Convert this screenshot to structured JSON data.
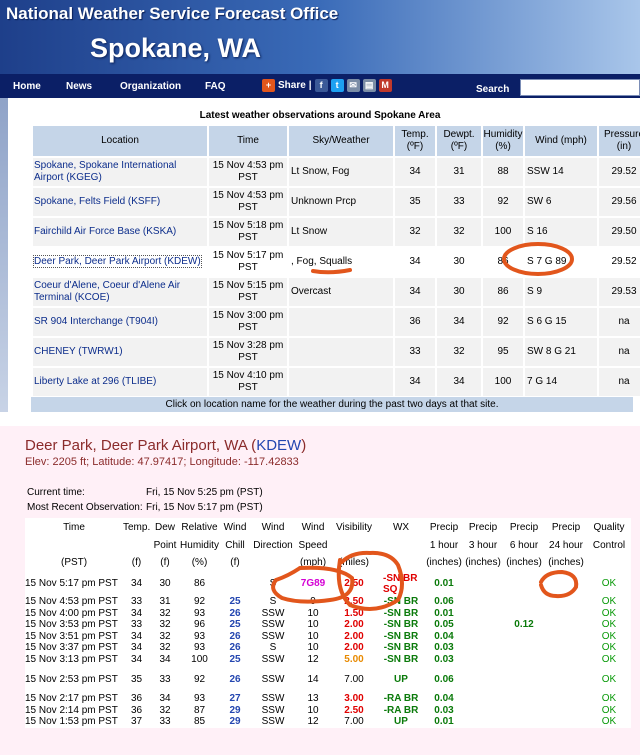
{
  "header": {
    "office": "National Weather Service Forecast Office",
    "city": "Spokane, WA"
  },
  "nav": {
    "items": [
      "Home",
      "News",
      "Organization",
      "FAQ"
    ],
    "share_label": "Share",
    "share_separator": "|",
    "search_label": "Search"
  },
  "obs": {
    "title": "Latest weather observations around Spokane Area",
    "headers": {
      "location": "Location",
      "time": "Time",
      "sky": "Sky/Weather",
      "temp": "Temp. (ºF)",
      "dewpt": "Dewpt. (ºF)",
      "humidity": "Humidity (%)",
      "wind": "Wind (mph)",
      "pressure": "Pressure (in)"
    },
    "rows": [
      {
        "location": "Spokane, Spokane International Airport (KGEG)",
        "time": "15 Nov 4:53 pm PST",
        "sky": "Lt Snow, Fog",
        "temp": "34",
        "dewpt": "31",
        "humidity": "88",
        "wind": "SSW 14",
        "pressure": "29.52"
      },
      {
        "location": "Spokane, Felts Field (KSFF)",
        "time": "15 Nov 4:53 pm PST",
        "sky": "Unknown Prcp",
        "temp": "35",
        "dewpt": "33",
        "humidity": "92",
        "wind": "SW 6",
        "pressure": "29.56"
      },
      {
        "location": "Fairchild Air Force Base (KSKA)",
        "time": "15 Nov 5:18 pm PST",
        "sky": "Lt Snow",
        "temp": "32",
        "dewpt": "32",
        "humidity": "100",
        "wind": "S 16",
        "pressure": "29.50"
      },
      {
        "location": "Deer Park, Deer Park Airport (KDEW)",
        "time": "15 Nov 5:17 pm PST",
        "sky": ", Fog, Squalls",
        "temp": "34",
        "dewpt": "30",
        "humidity": "86",
        "wind": "S 7 G 89",
        "pressure": "29.52"
      },
      {
        "location": "Coeur d'Alene, Coeur d'Alene Air Terminal (KCOE)",
        "time": "15 Nov 5:15 pm PST",
        "sky": "Overcast",
        "temp": "34",
        "dewpt": "30",
        "humidity": "86",
        "wind": "S 9",
        "pressure": "29.53"
      },
      {
        "location": "SR 904 Interchange (T904I)",
        "time": "15 Nov 3:00 pm PST",
        "sky": "",
        "temp": "36",
        "dewpt": "34",
        "humidity": "92",
        "wind": "S 6 G 15",
        "pressure": "na"
      },
      {
        "location": "CHENEY (TWRW1)",
        "time": "15 Nov 3:28 pm PST",
        "sky": "",
        "temp": "33",
        "dewpt": "32",
        "humidity": "95",
        "wind": "SW 8 G 21",
        "pressure": "na"
      },
      {
        "location": "Liberty Lake at 296 (TLIBE)",
        "time": "15 Nov 4:10 pm PST",
        "sky": "",
        "temp": "34",
        "dewpt": "34",
        "humidity": "100",
        "wind": "7 G 14",
        "pressure": "na"
      }
    ],
    "note": "Click on location name for the weather during the past two days at that site."
  },
  "station": {
    "name": "Deer Park, Deer Park Airport, WA (",
    "id": "KDEW",
    "name_close": ")",
    "elev_line": "Elev: 2205 ft; Latitude: 47.97417; Longitude: -117.42833",
    "current_time_label": "Current time:",
    "current_time": "Fri, 15 Nov 5:25 pm (PST)",
    "recent_obs_label": "Most Recent Observation:",
    "recent_obs": "Fri, 15 Nov 5:17 pm (PST)"
  },
  "hist": {
    "header_row1": [
      "Time",
      "Temp.",
      "Dew",
      "Relative",
      "Wind",
      "Wind",
      "Wind",
      "Visibility",
      "WX",
      "Precip",
      "Precip",
      "Precip",
      "Precip",
      "Quality"
    ],
    "header_row2": [
      "",
      "",
      "Point",
      "Humidity",
      "Chill",
      "Direction",
      "Speed",
      "",
      "",
      "1 hour",
      "3 hour",
      "6 hour",
      "24 hour",
      "Control"
    ],
    "header_row3": [
      "(PST)",
      "(f)",
      "(f)",
      "(%)",
      "(f)",
      "",
      "(mph)",
      "(miles)",
      "",
      "(inches)",
      "(inches)",
      "(inches)",
      "(inches)",
      ""
    ],
    "rows": [
      {
        "time": "15 Nov 5:17 pm PST",
        "temp": "34",
        "dew": "30",
        "rh": "86",
        "chill": "",
        "dir": "S",
        "speed_a": "7",
        "speed_b": "G89",
        "vis": "2.50",
        "wx": "-SN BR SQ",
        "p1": "0.01",
        "p3": "",
        "p6": "",
        "p24": "",
        "qc": "OK"
      },
      {
        "time": "15 Nov 4:53 pm PST",
        "temp": "33",
        "dew": "31",
        "rh": "92",
        "chill": "25",
        "dir": "S",
        "speed_a": "9",
        "speed_b": "",
        "vis": "2.50",
        "wx": "-SN BR",
        "p1": "0.06",
        "p3": "",
        "p6": "",
        "p24": "",
        "qc": "OK"
      },
      {
        "time": "15 Nov 4:00 pm PST",
        "temp": "34",
        "dew": "32",
        "rh": "93",
        "chill": "26",
        "dir": "SSW",
        "speed_a": "10",
        "speed_b": "",
        "vis": "1.50",
        "wx": "-SN BR",
        "p1": "0.01",
        "p3": "",
        "p6": "",
        "p24": "",
        "qc": "OK"
      },
      {
        "time": "15 Nov 3:53 pm PST",
        "temp": "33",
        "dew": "32",
        "rh": "96",
        "chill": "25",
        "dir": "SSW",
        "speed_a": "10",
        "speed_b": "",
        "vis": "2.00",
        "wx": "-SN BR",
        "p1": "0.05",
        "p3": "",
        "p6": "0.12",
        "p24": "",
        "qc": "OK"
      },
      {
        "time": "15 Nov 3:51 pm PST",
        "temp": "34",
        "dew": "32",
        "rh": "93",
        "chill": "26",
        "dir": "SSW",
        "speed_a": "10",
        "speed_b": "",
        "vis": "2.00",
        "wx": "-SN BR",
        "p1": "0.04",
        "p3": "",
        "p6": "",
        "p24": "",
        "qc": "OK"
      },
      {
        "time": "15 Nov 3:37 pm PST",
        "temp": "34",
        "dew": "32",
        "rh": "93",
        "chill": "26",
        "dir": "S",
        "speed_a": "10",
        "speed_b": "",
        "vis": "2.00",
        "wx": "-SN BR",
        "p1": "0.03",
        "p3": "",
        "p6": "",
        "p24": "",
        "qc": "OK"
      },
      {
        "time": "15 Nov 3:13 pm PST",
        "temp": "34",
        "dew": "34",
        "rh": "100",
        "chill": "25",
        "dir": "SSW",
        "speed_a": "12",
        "speed_b": "",
        "vis": "5.00",
        "wx": "-SN BR",
        "p1": "0.03",
        "p3": "",
        "p6": "",
        "p24": "",
        "qc": "OK"
      },
      {
        "time": "15 Nov 2:53 pm PST",
        "temp": "35",
        "dew": "33",
        "rh": "92",
        "chill": "26",
        "dir": "SSW",
        "speed_a": "14",
        "speed_b": "",
        "vis": "7.00",
        "wx": "UP",
        "p1": "0.06",
        "p3": "",
        "p6": "",
        "p24": "",
        "qc": "OK"
      },
      {
        "time": "15 Nov 2:17 pm PST",
        "temp": "36",
        "dew": "34",
        "rh": "93",
        "chill": "27",
        "dir": "SSW",
        "speed_a": "13",
        "speed_b": "",
        "vis": "3.00",
        "wx": "-RA BR",
        "p1": "0.04",
        "p3": "",
        "p6": "",
        "p24": "",
        "qc": "OK"
      },
      {
        "time": "15 Nov 2:14 pm PST",
        "temp": "36",
        "dew": "32",
        "rh": "87",
        "chill": "29",
        "dir": "SSW",
        "speed_a": "10",
        "speed_b": "",
        "vis": "2.50",
        "wx": "-RA BR",
        "p1": "0.03",
        "p3": "",
        "p6": "",
        "p24": "",
        "qc": "OK"
      },
      {
        "time": "15 Nov 1:53 pm PST",
        "temp": "37",
        "dew": "33",
        "rh": "85",
        "chill": "29",
        "dir": "SSW",
        "speed_a": "12",
        "speed_b": "",
        "vis": "7.00",
        "wx": "UP",
        "p1": "0.01",
        "p3": "",
        "p6": "",
        "p24": "",
        "qc": "OK"
      }
    ]
  },
  "colors": {
    "annotation": "#e2561c",
    "nav_bg": "#0b1f66",
    "link": "#0b2c8b",
    "station_name": "#8b2b2b"
  },
  "icons": [
    "plus-share-icon",
    "facebook-icon",
    "twitter-icon",
    "email-icon",
    "print-icon",
    "bookmark-icon"
  ]
}
